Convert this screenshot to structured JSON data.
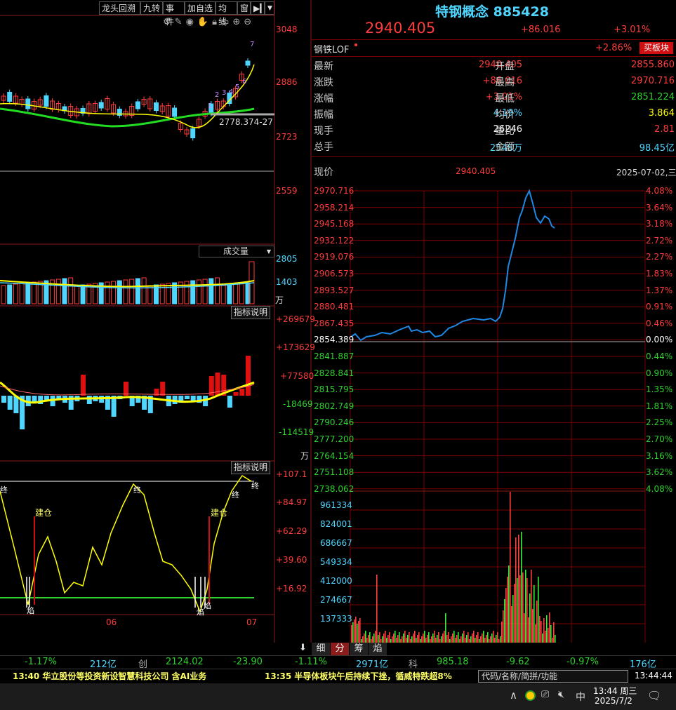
{
  "toolbar": {
    "buttons": [
      "龙头回溯",
      "九转",
      "事件",
      "加自选",
      "均线",
      "窗"
    ],
    "play_icon": "play-icon",
    "dropdown_icon": "chevron-down-icon"
  },
  "left_panel": {
    "kline_right_axis": [
      "3048",
      "2886",
      "2723",
      "2559"
    ],
    "kline_ma_label": "2778.374-27",
    "kline_markers": [
      "1",
      "2",
      "3",
      "4",
      "5",
      "6",
      "7"
    ],
    "volume_selector": "成交量",
    "volume_axis": [
      "2805",
      "1403"
    ],
    "volume_unit": "万",
    "indicator1_label": "指标说明",
    "indicator1_axis": [
      "+269679",
      "+173629",
      "+77580",
      "-18469",
      "-114519"
    ],
    "indicator1_unit": "万",
    "indicator2_label": "指标说明",
    "indicator2_axis": [
      "+107.1",
      "+84.97",
      "+62.29",
      "+39.60",
      "+16.92"
    ],
    "ind2_tags": [
      "建仓",
      "建仓",
      "终",
      "终",
      "终",
      "终",
      "焰",
      "焰",
      "焰"
    ],
    "date_labels": [
      "06",
      "07"
    ]
  },
  "quote": {
    "name": "特钢概念 885428",
    "price": "2940.405",
    "change": "+86.016",
    "change_pct": "+3.01%",
    "related_name": "钢铁LOF",
    "related_pct": "+2.86%",
    "buy_block": "买板块",
    "rows": [
      {
        "l1": "最新",
        "v1": "2940.405",
        "c1": "red",
        "l2": "开盘",
        "v2": "2855.860",
        "c2": "red"
      },
      {
        "l1": "涨跌",
        "v1": "+86.016",
        "c1": "red",
        "l2": "最高",
        "v2": "2970.716",
        "c2": "red"
      },
      {
        "l1": "涨幅",
        "v1": "+3.01%",
        "c1": "red",
        "l2": "最低",
        "v2": "2851.224",
        "c2": "green"
      },
      {
        "l1": "振幅",
        "v1": "4.19%",
        "c1": "cyan",
        "l2": "均价",
        "v2": "3.864",
        "c2": "yellow"
      },
      {
        "l1": "现手",
        "v1": "26246",
        "c1": "white",
        "l2": "量比",
        "v2": "2.81",
        "c2": "red"
      },
      {
        "l1": "总手",
        "v1": "2548万",
        "c1": "cyan",
        "l2": "金额",
        "v2": "98.45亿",
        "c2": "cyan"
      }
    ]
  },
  "intraday": {
    "now_label": "现价",
    "now_value": "2940.405",
    "date_label": "2025-07-02,三",
    "left_axis": [
      "2970.716",
      "2958.214",
      "2945.168",
      "2932.122",
      "2919.076",
      "2906.573",
      "2893.527",
      "2880.481",
      "2867.435",
      "2854.389",
      "2841.887",
      "2828.841",
      "2815.795",
      "2802.749",
      "2790.246",
      "2777.200",
      "2764.154",
      "2751.108",
      "2738.062"
    ],
    "right_axis": [
      "4.08%",
      "3.64%",
      "3.18%",
      "2.72%",
      "2.27%",
      "1.83%",
      "1.37%",
      "0.91%",
      "0.46%",
      "0.00%",
      "0.44%",
      "0.90%",
      "1.35%",
      "1.81%",
      "2.25%",
      "2.70%",
      "3.16%",
      "3.62%",
      "4.08%"
    ],
    "vol_axis": [
      "961334",
      "824001",
      "686667",
      "549334",
      "412000",
      "274667",
      "137333"
    ]
  },
  "bottom_tabs": [
    "细",
    "分",
    "筹",
    "焰"
  ],
  "index_bar": [
    {
      "text": "-1.17%",
      "color": "green"
    },
    {
      "text": "212亿",
      "color": "cyan"
    },
    {
      "text": "创",
      "color": "gray"
    },
    {
      "text": "2124.02",
      "color": "green"
    },
    {
      "text": "-23.90",
      "color": "green"
    },
    {
      "text": "-1.11%",
      "color": "green"
    },
    {
      "text": "2971亿",
      "color": "cyan"
    },
    {
      "text": "科",
      "color": "gray"
    },
    {
      "text": "985.18",
      "color": "green"
    },
    {
      "text": "-9.62",
      "color": "green"
    },
    {
      "text": "-0.97%",
      "color": "green"
    },
    {
      "text": "176亿",
      "color": "cyan"
    }
  ],
  "news": {
    "item1": "13:40 华立股份等投资新设智慧科技公司 含AI业务",
    "item2": "13:35 半导体板块午后持续下挫，循威特跌超8%",
    "search_placeholder": "代码/名称/简拼/功能",
    "clock": "13:44:44"
  },
  "taskbar": {
    "time": "13:44 周三",
    "date": "2025/7/2",
    "ime": "中"
  },
  "colors": {
    "up": "#ff3c3c",
    "down": "#2fd12f",
    "cyan": "#4fd6ff",
    "yellow": "#ffff00",
    "grid": "#7a0000"
  }
}
